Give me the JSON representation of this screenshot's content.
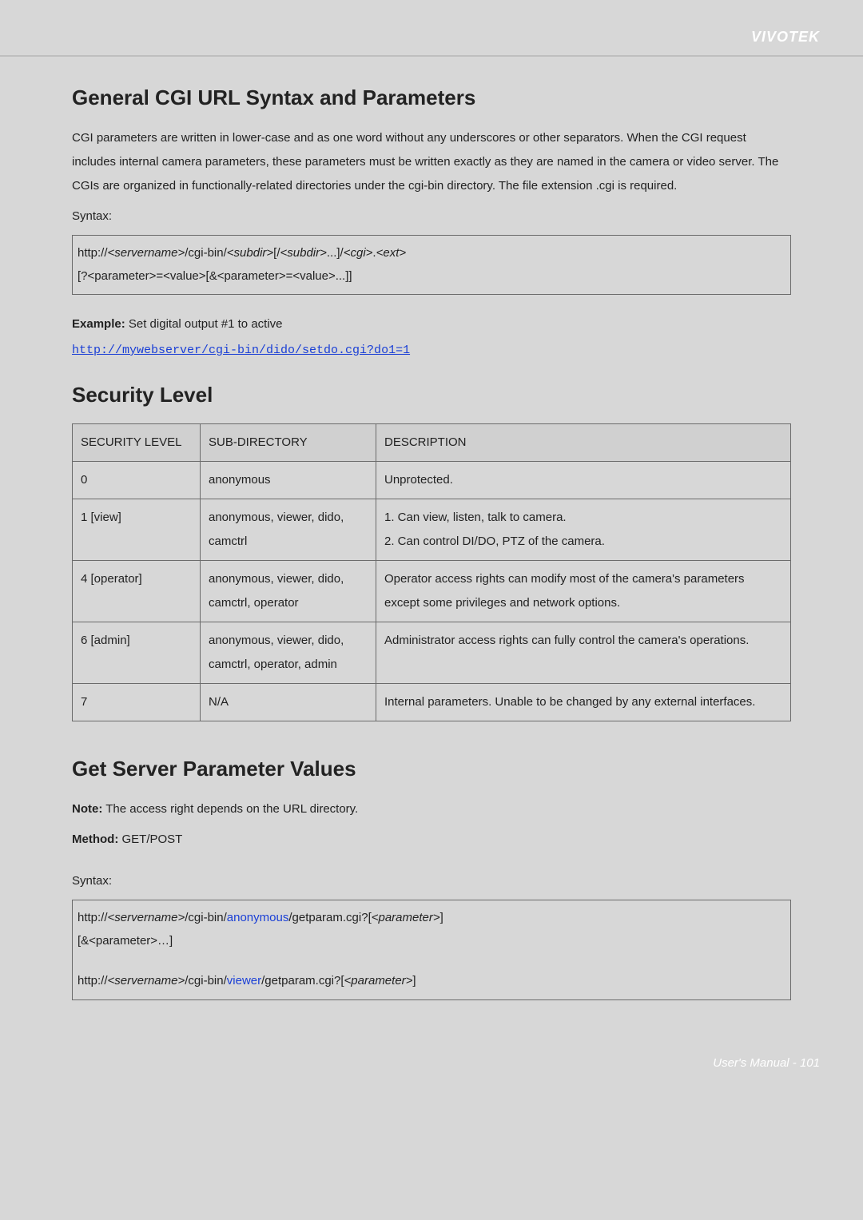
{
  "header": {
    "brand": "VIVOTEK"
  },
  "section1": {
    "title": "General CGI URL Syntax and Parameters",
    "para": "CGI parameters are written in lower-case and as one word without any underscores or other separators. When the CGI request includes internal camera parameters, these parameters must be written exactly as they are named in the camera or video server. The CGIs are organized in functionally-related directories under the cgi-bin directory. The file extension .cgi is required.",
    "syntax_label": "Syntax:",
    "syntax": {
      "l1_a": "http://",
      "l1_b": "<servername>",
      "l1_c": "/cgi-bin/",
      "l1_d": "<subdir>",
      "l1_e": "[/",
      "l1_f": "<subdir>",
      "l1_g": "...]/",
      "l1_h": "<cgi>",
      "l1_i": ".",
      "l1_j": "<ext>",
      "l2": "[?<parameter>=<value>[&<parameter>=<value>...]]"
    },
    "example_label": "Example:",
    "example_text": " Set digital output #1 to active",
    "example_url": "http://mywebserver/cgi-bin/dido/setdo.cgi?do1=1"
  },
  "section2": {
    "title": "Security Level",
    "table": {
      "headers": [
        "SECURITY LEVEL",
        "SUB-DIRECTORY",
        "DESCRIPTION"
      ],
      "rows": [
        {
          "level": "0",
          "subdir": "anonymous",
          "desc": "Unprotected."
        },
        {
          "level": "1 [view]",
          "subdir": "anonymous, viewer, dido, camctrl",
          "desc": "1. Can view, listen, talk to camera.\n2. Can control DI/DO, PTZ of the camera."
        },
        {
          "level": "4 [operator]",
          "subdir": "anonymous, viewer, dido, camctrl, operator",
          "desc": "Operator access rights can modify most of the camera's parameters except some privileges and network options."
        },
        {
          "level": "6 [admin]",
          "subdir": "anonymous, viewer, dido, camctrl, operator, admin",
          "desc": "Administrator access rights can fully control the camera's operations."
        },
        {
          "level": "7",
          "subdir": "N/A",
          "desc": "Internal parameters. Unable to be changed by any external interfaces."
        }
      ]
    }
  },
  "section3": {
    "title": "Get Server Parameter Values",
    "note_label": "Note:",
    "note_text": " The access right depends on the URL directory.",
    "method_label": "Method:",
    "method_text": " GET/POST",
    "syntax_label": "Syntax:",
    "syntax": {
      "la_a": "http://",
      "la_b": "<servername>",
      "la_c": "/cgi-bin/",
      "la_d": "anonymous",
      "la_e": "/getparam.cgi?[",
      "la_f": "<parameter>",
      "la_g": "]",
      "lb": "[&<parameter>…]",
      "lc_a": "http://",
      "lc_b": "<servername>",
      "lc_c": "/cgi-bin/",
      "lc_d": "viewer",
      "lc_e": "/getparam.cgi?[",
      "lc_f": "<parameter>",
      "lc_g": "]"
    }
  },
  "footer": {
    "text": "User's Manual - 101"
  }
}
